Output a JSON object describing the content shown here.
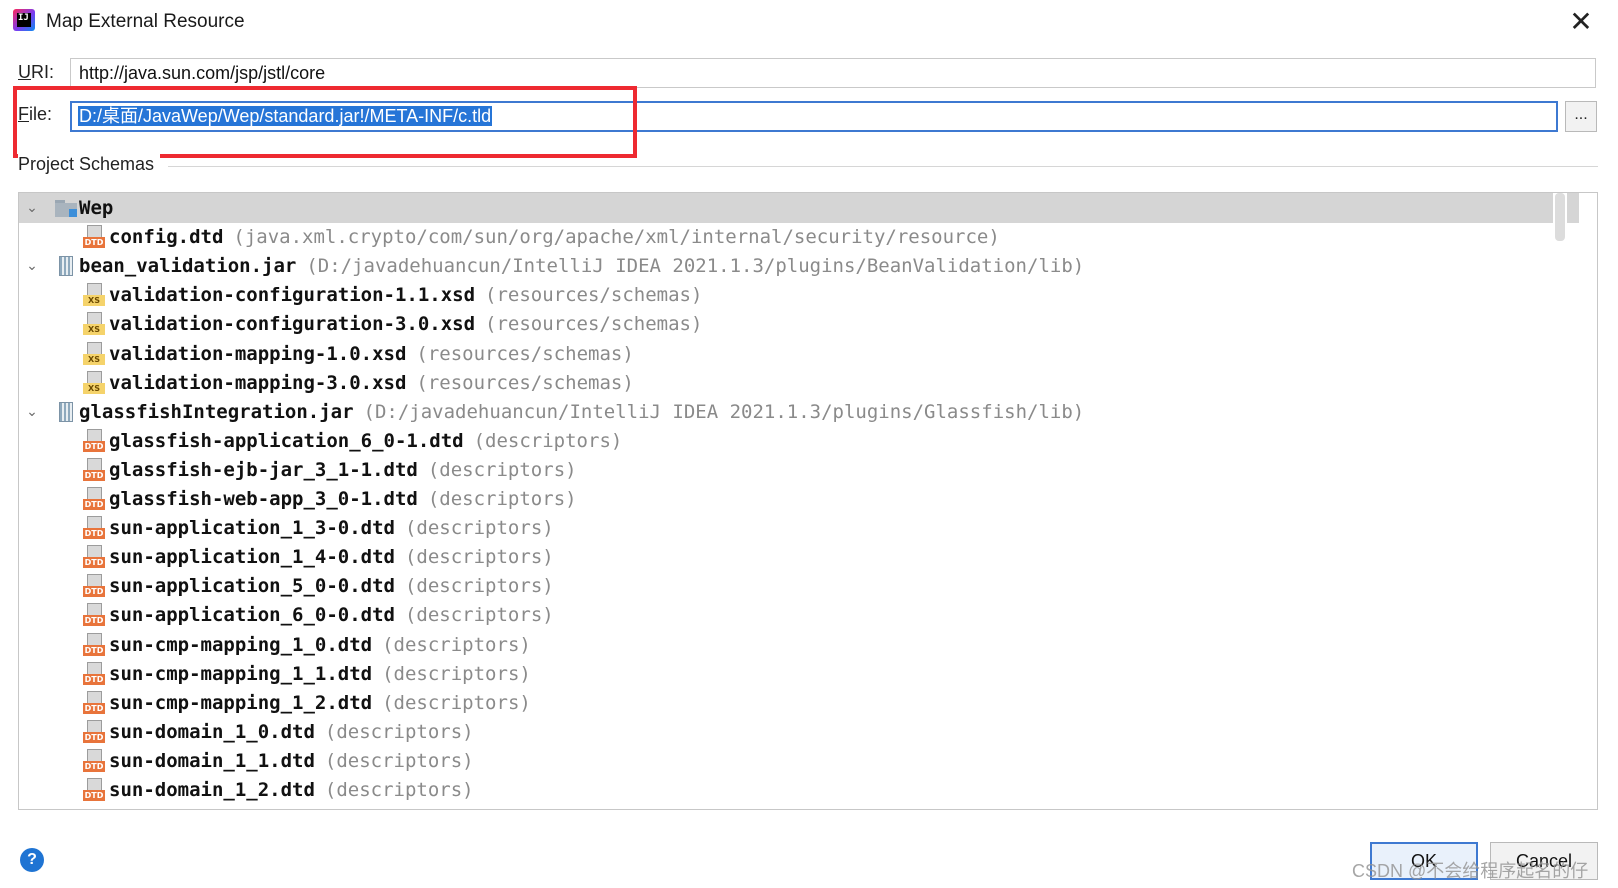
{
  "window": {
    "title": "Map External Resource"
  },
  "form": {
    "uri_label": "URI:",
    "uri_value": "http://java.sun.com/jsp/jstl/core",
    "file_label": "File:",
    "file_value": "D:/桌面/JavaWep/Wep/standard.jar!/META-INF/c.tld",
    "browse_label": "..."
  },
  "schemas": {
    "section_label": "Project Schemas",
    "rows": [
      {
        "level": 0,
        "kind": "folder",
        "name": "Wep",
        "path": "",
        "selected": true
      },
      {
        "level": 1,
        "kind": "dtd",
        "name": "config.dtd",
        "path": "(java.xml.crypto/com/sun/org/apache/xml/internal/security/resource)"
      },
      {
        "level": 0,
        "kind": "jar",
        "name": "bean_validation.jar",
        "path": "(D:/javadehuancun/IntelliJ IDEA 2021.1.3/plugins/BeanValidation/lib)"
      },
      {
        "level": 1,
        "kind": "xsd",
        "name": "validation-configuration-1.1.xsd",
        "path": "(resources/schemas)"
      },
      {
        "level": 1,
        "kind": "xsd",
        "name": "validation-configuration-3.0.xsd",
        "path": "(resources/schemas)"
      },
      {
        "level": 1,
        "kind": "xsd",
        "name": "validation-mapping-1.0.xsd",
        "path": "(resources/schemas)"
      },
      {
        "level": 1,
        "kind": "xsd",
        "name": "validation-mapping-3.0.xsd",
        "path": "(resources/schemas)"
      },
      {
        "level": 0,
        "kind": "jar",
        "name": "glassfishIntegration.jar",
        "path": "(D:/javadehuancun/IntelliJ IDEA 2021.1.3/plugins/Glassfish/lib)"
      },
      {
        "level": 1,
        "kind": "dtd",
        "name": "glassfish-application_6_0-1.dtd",
        "path": "(descriptors)"
      },
      {
        "level": 1,
        "kind": "dtd",
        "name": "glassfish-ejb-jar_3_1-1.dtd",
        "path": "(descriptors)"
      },
      {
        "level": 1,
        "kind": "dtd",
        "name": "glassfish-web-app_3_0-1.dtd",
        "path": "(descriptors)"
      },
      {
        "level": 1,
        "kind": "dtd",
        "name": "sun-application_1_3-0.dtd",
        "path": "(descriptors)"
      },
      {
        "level": 1,
        "kind": "dtd",
        "name": "sun-application_1_4-0.dtd",
        "path": "(descriptors)"
      },
      {
        "level": 1,
        "kind": "dtd",
        "name": "sun-application_5_0-0.dtd",
        "path": "(descriptors)"
      },
      {
        "level": 1,
        "kind": "dtd",
        "name": "sun-application_6_0-0.dtd",
        "path": "(descriptors)"
      },
      {
        "level": 1,
        "kind": "dtd",
        "name": "sun-cmp-mapping_1_0.dtd",
        "path": "(descriptors)"
      },
      {
        "level": 1,
        "kind": "dtd",
        "name": "sun-cmp-mapping_1_1.dtd",
        "path": "(descriptors)"
      },
      {
        "level": 1,
        "kind": "dtd",
        "name": "sun-cmp-mapping_1_2.dtd",
        "path": "(descriptors)"
      },
      {
        "level": 1,
        "kind": "dtd",
        "name": "sun-domain_1_0.dtd",
        "path": "(descriptors)"
      },
      {
        "level": 1,
        "kind": "dtd",
        "name": "sun-domain_1_1.dtd",
        "path": "(descriptors)"
      },
      {
        "level": 1,
        "kind": "dtd",
        "name": "sun-domain_1_2.dtd",
        "path": "(descriptors)"
      }
    ]
  },
  "footer": {
    "help_label": "?",
    "ok_label": "OK",
    "cancel_label": "Cancel",
    "watermark": "CSDN @不会给程序起名的仔"
  },
  "icons": {
    "app": "intellij-idea-icon",
    "close": "close-icon",
    "help": "help-icon"
  },
  "colors": {
    "selection": "#2675d7",
    "focus_border": "#3e79d1",
    "annotation_box": "#ee2a31",
    "dtd_badge": "#e8743b",
    "xsd_badge": "#f5d36b"
  }
}
